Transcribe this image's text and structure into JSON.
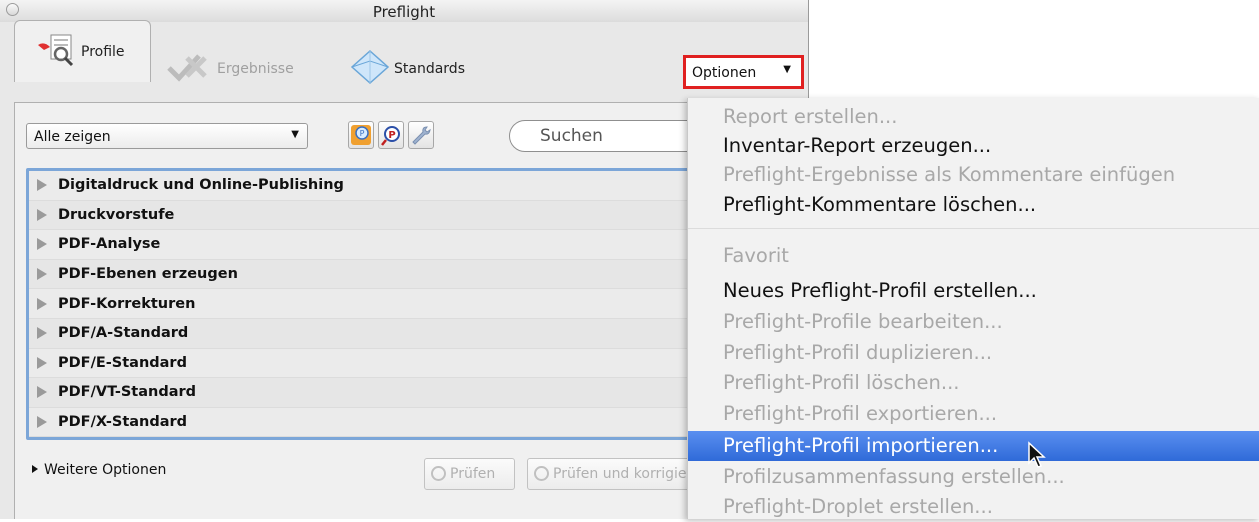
{
  "window": {
    "title": "Preflight"
  },
  "tabs": [
    {
      "label": "Profile",
      "state": "active"
    },
    {
      "label": "Ergebnisse",
      "state": "disabled"
    },
    {
      "label": "Standards",
      "state": "normal"
    }
  ],
  "options_button": {
    "label": "Optionen"
  },
  "toolbar": {
    "filter_value": "Alle zeigen",
    "search_placeholder": "Suchen",
    "icons": [
      "profile-favorite-icon",
      "preflight-search-icon",
      "wrench-icon"
    ]
  },
  "profile_groups": [
    "Digitaldruck und Online-Publishing",
    "Druckvorstufe",
    "PDF-Analyse",
    "PDF-Ebenen erzeugen",
    "PDF-Korrekturen",
    "PDF/A-Standard",
    "PDF/E-Standard",
    "PDF/VT-Standard",
    "PDF/X-Standard"
  ],
  "bottom": {
    "more_options": "Weitere Optionen",
    "check_button": "Prüfen",
    "check_and_fix_button": "Prüfen und korrigieren"
  },
  "menu": {
    "items": [
      {
        "label": "Report erstellen...",
        "enabled": false
      },
      {
        "label": "Inventar-Report erzeugen...",
        "enabled": true
      },
      {
        "label": "Preflight-Ergebnisse als Kommentare einfügen",
        "enabled": false
      },
      {
        "label": "Preflight-Kommentare löschen...",
        "enabled": true
      },
      {
        "label": "Favorit",
        "enabled": false
      },
      {
        "label": "Neues Preflight-Profil erstellen...",
        "enabled": true
      },
      {
        "label": "Preflight-Profile bearbeiten...",
        "enabled": false
      },
      {
        "label": "Preflight-Profil duplizieren...",
        "enabled": false
      },
      {
        "label": "Preflight-Profil löschen...",
        "enabled": false
      },
      {
        "label": "Preflight-Profil exportieren...",
        "enabled": false
      },
      {
        "label": "Preflight-Profil importieren...",
        "enabled": true,
        "highlighted": true
      },
      {
        "label": "Profilzusammenfassung erstellen...",
        "enabled": false
      },
      {
        "label": "Preflight-Droplet erstellen...",
        "enabled": false
      }
    ]
  },
  "colors": {
    "highlight_box": "#e02020",
    "menu_highlight": "#3a74e0",
    "list_border": "#7ca6d8"
  }
}
